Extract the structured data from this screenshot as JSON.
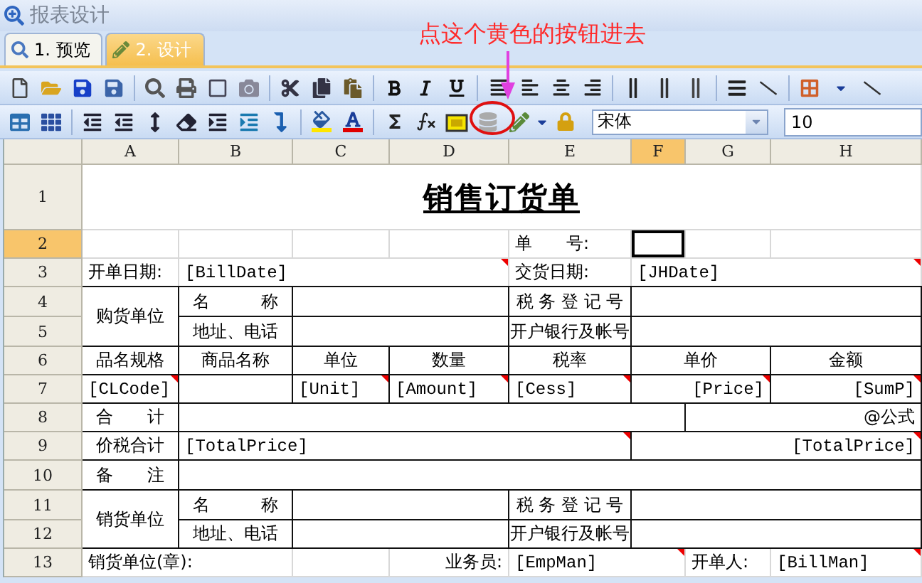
{
  "window": {
    "title": "报表设计"
  },
  "tabs": [
    {
      "label": "1. 预览",
      "selected": false
    },
    {
      "label": "2. 设计",
      "selected": true
    }
  ],
  "annotation": {
    "text": "点这个黄色的按钮进去"
  },
  "font_select": {
    "value": "宋体"
  },
  "size_field": {
    "value": "10"
  },
  "columns": [
    {
      "label": "A",
      "selected": false
    },
    {
      "label": "B",
      "selected": false
    },
    {
      "label": "C",
      "selected": false
    },
    {
      "label": "D",
      "selected": false
    },
    {
      "label": "E",
      "selected": false
    },
    {
      "label": "F",
      "selected": true
    },
    {
      "label": "G",
      "selected": false
    },
    {
      "label": "H",
      "selected": false
    }
  ],
  "rows": [
    {
      "label": "1",
      "selected": false,
      "cells": [
        {
          "text": "销售订货单",
          "kind": "title"
        }
      ]
    },
    {
      "label": "2",
      "selected": true,
      "cells": [
        {
          "text": "单　　号:"
        },
        {
          "active": true
        }
      ]
    },
    {
      "label": "3",
      "selected": false,
      "cells": [
        {
          "text": "开单日期:"
        },
        {
          "text": "[BillDate]",
          "kind": "field",
          "comment": true
        },
        {
          "text": "交货日期:"
        },
        {
          "text": "[JHDate]",
          "kind": "field",
          "comment": true
        }
      ]
    },
    {
      "label": "4",
      "selected": false,
      "cells": [
        {
          "text": "购货单位"
        },
        {
          "text": "名　　　称"
        },
        {
          "text": "税 务 登 记 号"
        }
      ]
    },
    {
      "label": "5",
      "selected": false,
      "cells": [
        {
          "text": "地址、电话"
        },
        {
          "text": "开户银行及帐号"
        }
      ]
    },
    {
      "label": "6",
      "selected": false,
      "cells": [
        {
          "text": "品名规格"
        },
        {
          "text": "商品名称"
        },
        {
          "text": "单位"
        },
        {
          "text": "数量"
        },
        {
          "text": "税率"
        },
        {
          "text": "单价"
        },
        {
          "text": "金额"
        }
      ]
    },
    {
      "label": "7",
      "selected": false,
      "cells": [
        {
          "text": "[CLCode]",
          "kind": "field",
          "comment": true
        },
        {
          "text": "[Unit]",
          "kind": "field",
          "comment": true
        },
        {
          "text": "[Amount]",
          "kind": "field",
          "comment": true
        },
        {
          "text": "[Cess]",
          "kind": "field",
          "comment": true
        },
        {
          "text": "[Price]",
          "kind": "field",
          "comment": true
        },
        {
          "text": "[SumP]",
          "kind": "field",
          "comment": true
        }
      ]
    },
    {
      "label": "8",
      "selected": false,
      "cells": [
        {
          "text": "合　　计"
        },
        {
          "text": "@公式"
        }
      ]
    },
    {
      "label": "9",
      "selected": false,
      "cells": [
        {
          "text": "价税合计"
        },
        {
          "text": "[TotalPrice]",
          "kind": "field",
          "comment": true
        },
        {
          "text": "[TotalPrice]",
          "kind": "field",
          "comment": true
        }
      ]
    },
    {
      "label": "10",
      "selected": false,
      "cells": [
        {
          "text": "备　　注"
        }
      ]
    },
    {
      "label": "11",
      "selected": false,
      "cells": [
        {
          "text": "销货单位"
        },
        {
          "text": "名　　　称"
        },
        {
          "text": "税 务 登 记 号"
        }
      ]
    },
    {
      "label": "12",
      "selected": false,
      "cells": [
        {
          "text": "地址、电话"
        },
        {
          "text": "开户银行及帐号"
        }
      ]
    },
    {
      "label": "13",
      "selected": false,
      "cells": [
        {
          "text": "销货单位(章):"
        },
        {
          "text": "业务员:"
        },
        {
          "text": "[EmpMan]",
          "kind": "field",
          "comment": true
        },
        {
          "text": "开单人:"
        },
        {
          "text": "[BillMan]",
          "kind": "field",
          "comment": true
        }
      ]
    }
  ]
}
